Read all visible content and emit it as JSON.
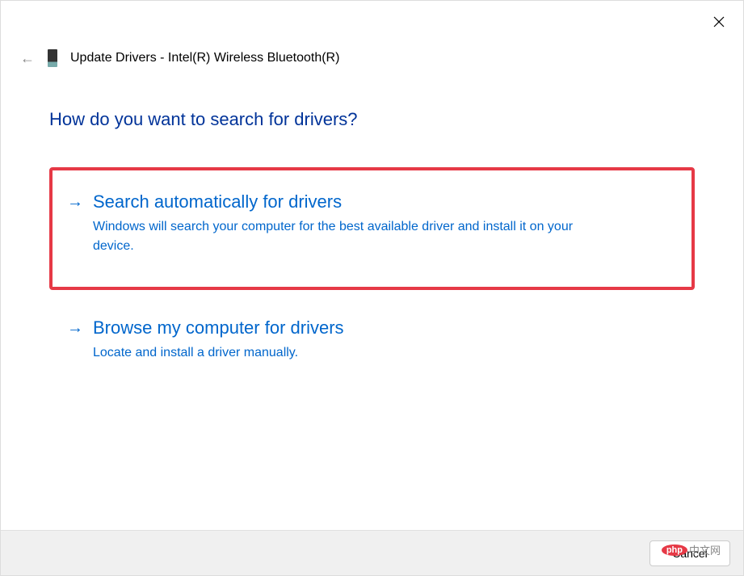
{
  "header": {
    "title": "Update Drivers - Intel(R) Wireless Bluetooth(R)"
  },
  "question": "How do you want to search for drivers?",
  "options": [
    {
      "title": "Search automatically for drivers",
      "description": "Windows will search your computer for the best available driver and install it on your device."
    },
    {
      "title": "Browse my computer for drivers",
      "description": "Locate and install a driver manually."
    }
  ],
  "footer": {
    "cancel_label": "Cancel"
  },
  "watermark": {
    "logo_text": "php",
    "suffix": "中文网"
  }
}
